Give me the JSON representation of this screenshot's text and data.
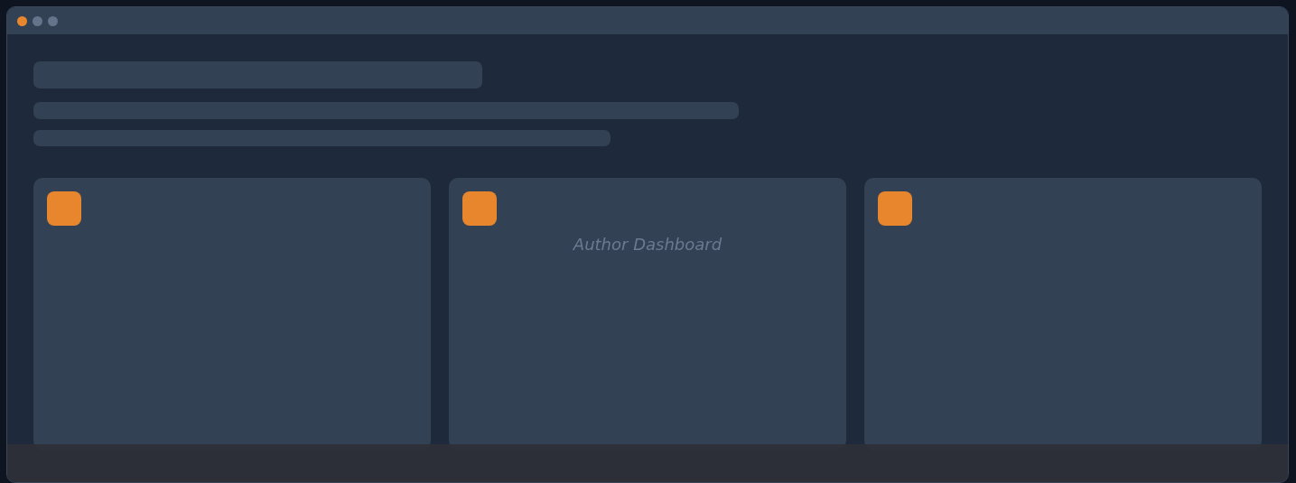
{
  "window": {
    "dots": [
      {
        "color": "#e8862e"
      },
      {
        "color": "#64748b"
      },
      {
        "color": "#64748b"
      }
    ]
  },
  "cards": [
    {
      "kind": "blank"
    },
    {
      "kind": "captioned",
      "caption": "Author Dashboard"
    },
    {
      "kind": "blank"
    }
  ]
}
